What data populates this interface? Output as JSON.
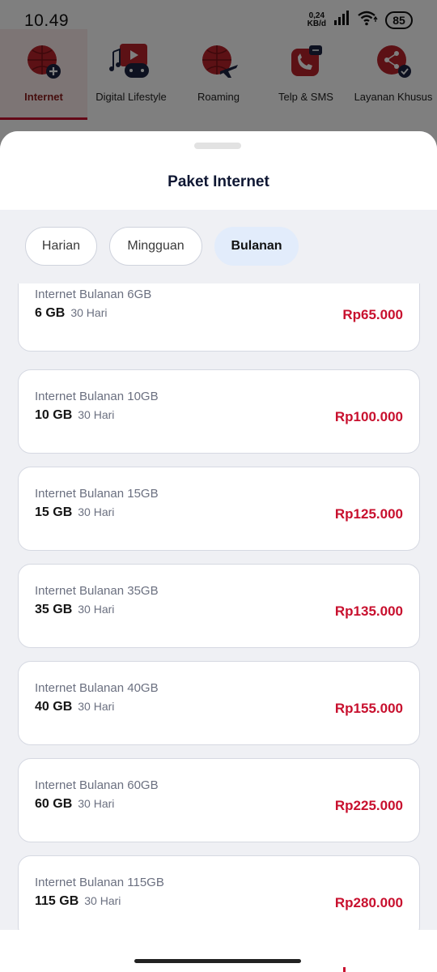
{
  "status": {
    "time": "10.49",
    "net_speed_value": "0,24",
    "net_speed_unit": "KB/d",
    "battery": "85"
  },
  "categories": [
    {
      "label": "Internet",
      "icon": "globe-plus-icon",
      "active": true
    },
    {
      "label": "Digital Lifestyle",
      "icon": "media-gamepad-icon",
      "active": false
    },
    {
      "label": "Roaming",
      "icon": "globe-plane-icon",
      "active": false
    },
    {
      "label": "Telp & SMS",
      "icon": "phone-chat-icon",
      "active": false
    },
    {
      "label": "Layanan Khusus",
      "icon": "share-network-icon",
      "active": false
    }
  ],
  "sheet": {
    "title": "Paket Internet",
    "tabs": [
      {
        "label": "Harian",
        "active": false
      },
      {
        "label": "Mingguan",
        "active": false
      },
      {
        "label": "Bulanan",
        "active": true
      }
    ],
    "packages": [
      {
        "name": "Internet Bulanan 6GB",
        "quota": "6 GB",
        "duration": "30 Hari",
        "price": "Rp65.000"
      },
      {
        "name": "Internet Bulanan 10GB",
        "quota": "10 GB",
        "duration": "30 Hari",
        "price": "Rp100.000"
      },
      {
        "name": "Internet Bulanan 15GB",
        "quota": "15 GB",
        "duration": "30 Hari",
        "price": "Rp125.000"
      },
      {
        "name": "Internet Bulanan 35GB",
        "quota": "35 GB",
        "duration": "30 Hari",
        "price": "Rp135.000"
      },
      {
        "name": "Internet Bulanan 40GB",
        "quota": "40 GB",
        "duration": "30 Hari",
        "price": "Rp155.000"
      },
      {
        "name": "Internet Bulanan 60GB",
        "quota": "60 GB",
        "duration": "30 Hari",
        "price": "Rp225.000"
      },
      {
        "name": "Internet Bulanan 115GB",
        "quota": "115 GB",
        "duration": "30 Hari",
        "price": "Rp280.000"
      }
    ]
  },
  "colors": {
    "brand_red": "#c8102e",
    "active_tab_bg": "#e2ecfb",
    "sheet_bg": "#eff0f4"
  }
}
